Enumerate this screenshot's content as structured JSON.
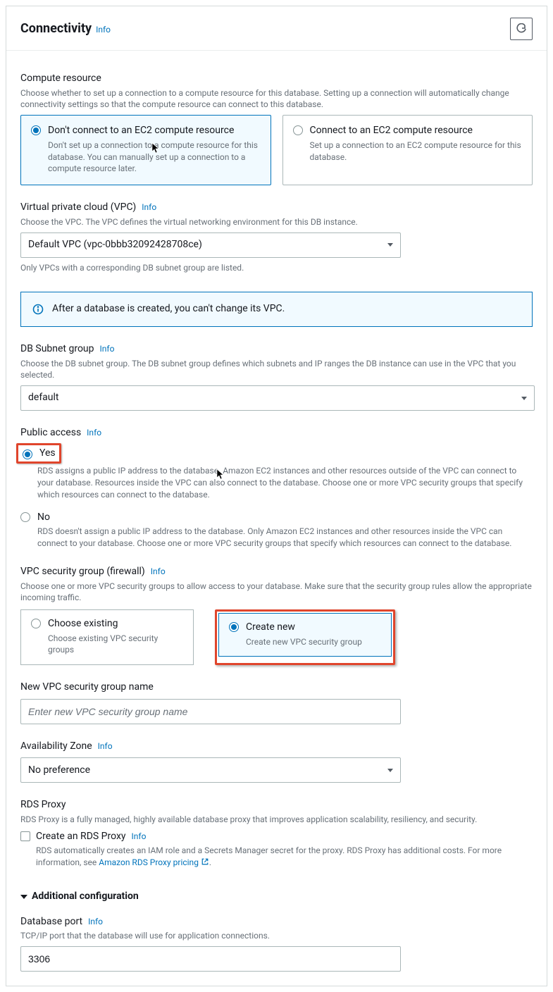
{
  "header": {
    "title": "Connectivity",
    "info": "Info"
  },
  "compute": {
    "label": "Compute resource",
    "desc": "Choose whether to set up a connection to a compute resource for this database. Setting up a connection will automatically change connectivity settings so that the compute resource can connect to this database.",
    "opt_a_title": "Don't connect to an EC2 compute resource",
    "opt_a_desc": "Don't set up a connection to a compute resource for this database. You can manually set up a connection to a compute resource later.",
    "opt_b_title": "Connect to an EC2 compute resource",
    "opt_b_desc": "Set up a connection to an EC2 compute resource for this database."
  },
  "vpc": {
    "label": "Virtual private cloud (VPC)",
    "info": "Info",
    "desc": "Choose the VPC. The VPC defines the virtual networking environment for this DB instance.",
    "value": "Default VPC (vpc-0bbb32092428708ce)",
    "hint": "Only VPCs with a corresponding DB subnet group are listed.",
    "alert": "After a database is created, you can't change its VPC."
  },
  "subnet": {
    "label": "DB Subnet group",
    "info": "Info",
    "desc": "Choose the DB subnet group. The DB subnet group defines which subnets and IP ranges the DB instance can use in the VPC that you selected.",
    "value": "default"
  },
  "public_access": {
    "label": "Public access",
    "info": "Info",
    "yes_label": "Yes",
    "yes_desc": "RDS assigns a public IP address to the database. Amazon EC2 instances and other resources outside of the VPC can connect to your database. Resources inside the VPC can also connect to the database. Choose one or more VPC security groups that specify which resources can connect to the database.",
    "no_label": "No",
    "no_desc": "RDS doesn't assign a public IP address to the database. Only Amazon EC2 instances and other resources inside the VPC can connect to your database. Choose one or more VPC security groups that specify which resources can connect to the database."
  },
  "sg": {
    "label": "VPC security group (firewall)",
    "info": "Info",
    "desc": "Choose one or more VPC security groups to allow access to your database. Make sure that the security group rules allow the appropriate incoming traffic.",
    "existing_title": "Choose existing",
    "existing_desc": "Choose existing VPC security groups",
    "create_title": "Create new",
    "create_desc": "Create new VPC security group"
  },
  "sg_name": {
    "label": "New VPC security group name",
    "placeholder": "Enter new VPC security group name"
  },
  "az": {
    "label": "Availability Zone",
    "info": "Info",
    "value": "No preference"
  },
  "proxy": {
    "label": "RDS Proxy",
    "desc": "RDS Proxy is a fully managed, highly available database proxy that improves application scalability, resiliency, and security.",
    "cb_label": "Create an RDS Proxy",
    "info": "Info",
    "cb_desc_a": "RDS automatically creates an IAM role and a Secrets Manager secret for the proxy. RDS Proxy has additional costs. For more information, see ",
    "cb_link": "Amazon RDS Proxy pricing",
    "cb_desc_b": "."
  },
  "additional": {
    "label": "Additional configuration"
  },
  "port": {
    "label": "Database port",
    "info": "Info",
    "desc": "TCP/IP port that the database will use for application connections.",
    "value": "3306"
  }
}
